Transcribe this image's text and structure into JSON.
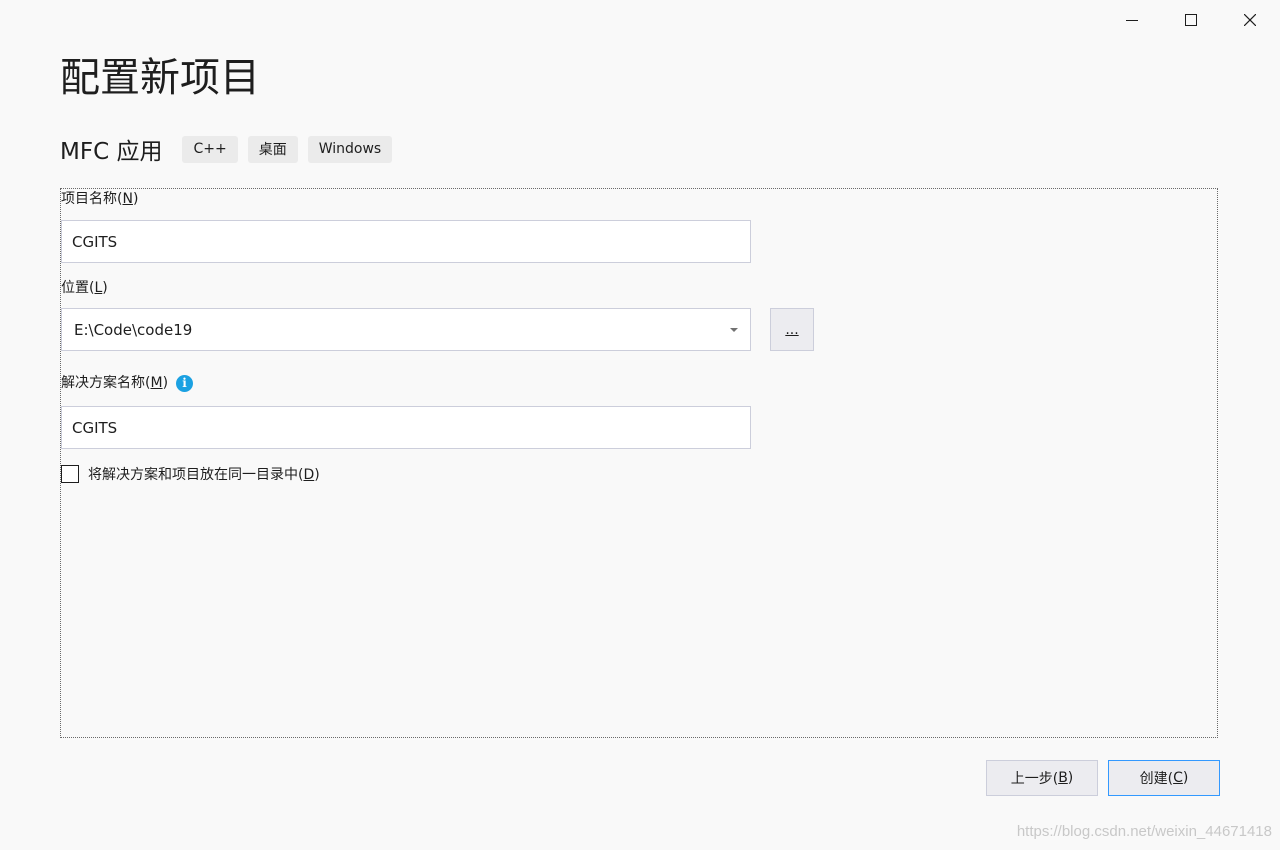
{
  "window": {
    "controls": {
      "minimize_icon": "minimize-icon",
      "maximize_icon": "maximize-icon",
      "close_icon": "close-icon"
    }
  },
  "header": {
    "title": "配置新项目",
    "template_name": "MFC 应用",
    "tags": [
      "C++",
      "桌面",
      "Windows"
    ]
  },
  "form": {
    "project_name": {
      "label_main": "项目名称(",
      "label_key": "N",
      "label_end": ")",
      "value": "CGITS"
    },
    "location": {
      "label_main": "位置(",
      "label_key": "L",
      "label_end": ")",
      "value": "E:\\Code\\code19",
      "browse_label": "..."
    },
    "solution_name": {
      "label_main": "解决方案名称(",
      "label_key": "M",
      "label_end": ")",
      "info_glyph": "i",
      "value": "CGITS"
    },
    "same_dir": {
      "label_main": "将解决方案和项目放在同一目录中(",
      "label_key": "D",
      "label_end": ")",
      "checked": false
    }
  },
  "footer": {
    "back_main": "上一步(",
    "back_key": "B",
    "back_end": ")",
    "create_main": "创建(",
    "create_key": "C",
    "create_end": ")"
  },
  "watermark": "https://blog.csdn.net/weixin_44671418",
  "colors": {
    "background": "#f9f9f9",
    "accent_border": "#3399ff",
    "info": "#1ba1e2"
  }
}
